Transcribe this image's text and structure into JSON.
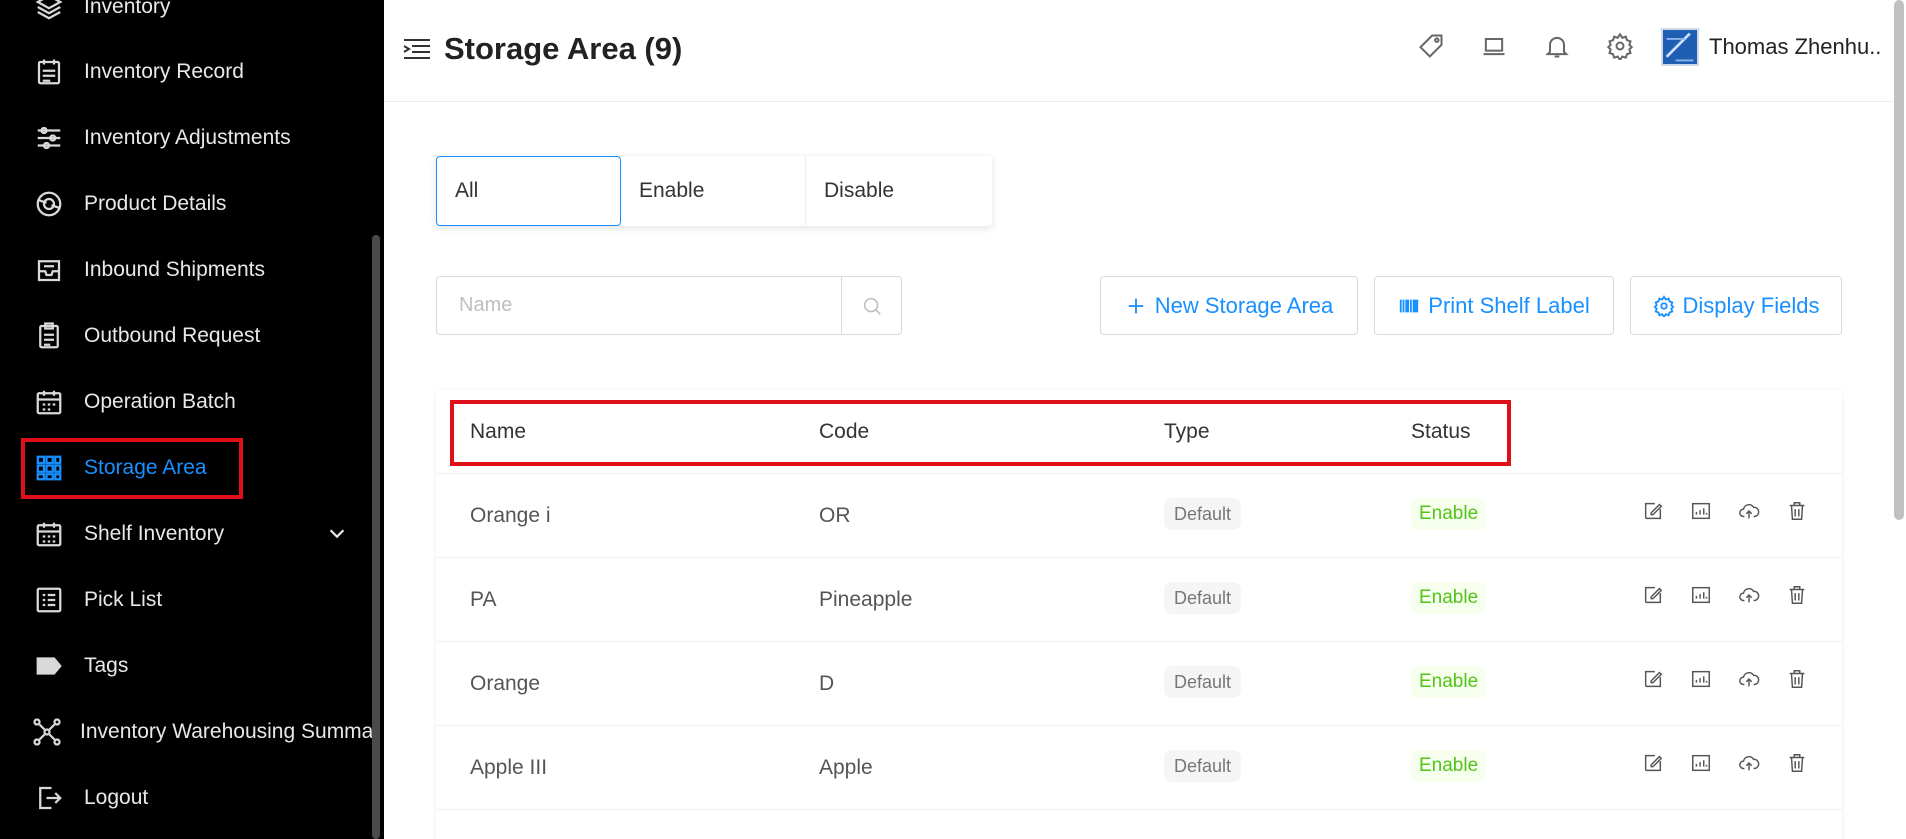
{
  "sidebar": {
    "items": [
      {
        "label": "Inventory",
        "icon": "layers-icon"
      },
      {
        "label": "Inventory Record",
        "icon": "record-icon"
      },
      {
        "label": "Inventory Adjustments",
        "icon": "sliders-icon"
      },
      {
        "label": "Product Details",
        "icon": "product-icon"
      },
      {
        "label": "Inbound Shipments",
        "icon": "inbox-icon"
      },
      {
        "label": "Outbound Request",
        "icon": "clipboard-icon"
      },
      {
        "label": "Operation Batch",
        "icon": "calendar-icon"
      },
      {
        "label": "Storage Area",
        "icon": "grid-icon",
        "active": true
      },
      {
        "label": "Shelf Inventory",
        "icon": "calendar-grid-icon",
        "expandable": true
      },
      {
        "label": "Pick List",
        "icon": "list-icon"
      },
      {
        "label": "Tags",
        "icon": "tag-icon"
      },
      {
        "label": "Inventory Warehousing Summar",
        "icon": "network-icon"
      },
      {
        "label": "Logout",
        "icon": "logout-icon"
      }
    ],
    "active_color": "#1890ff"
  },
  "header": {
    "title": "Storage Area (9)",
    "user_name": "Thomas Zhenhu.."
  },
  "tabs": [
    "All",
    "Enable",
    "Disable"
  ],
  "search": {
    "placeholder": "Name"
  },
  "actions": {
    "new": "New Storage Area",
    "print": "Print Shelf Label",
    "display": "Display Fields"
  },
  "table": {
    "columns": [
      "Name",
      "Code",
      "Type",
      "Status"
    ],
    "rows": [
      {
        "name": "Orange i",
        "code": "OR",
        "type": "Default",
        "status": "Enable"
      },
      {
        "name": "PA",
        "code": "Pineapple",
        "type": "Default",
        "status": "Enable"
      },
      {
        "name": "Orange",
        "code": "D",
        "type": "Default",
        "status": "Enable"
      },
      {
        "name": "Apple III",
        "code": "Apple",
        "type": "Default",
        "status": "Enable"
      }
    ]
  },
  "colors": {
    "accent": "#1890ff",
    "highlight": "#e0101a",
    "enable": "#52c41a"
  }
}
